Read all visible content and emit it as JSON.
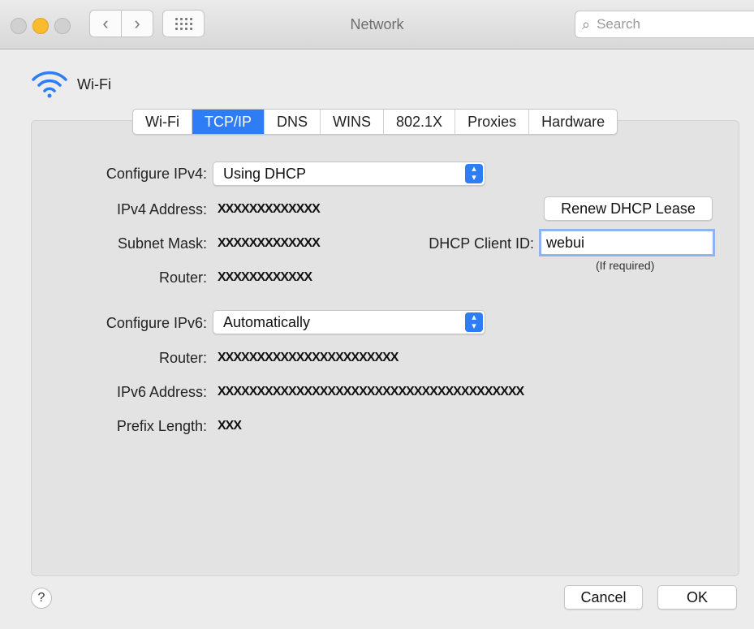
{
  "window": {
    "title": "Network"
  },
  "search": {
    "placeholder": "Search"
  },
  "service": {
    "name": "Wi-Fi"
  },
  "tabs": [
    "Wi-Fi",
    "TCP/IP",
    "DNS",
    "WINS",
    "802.1X",
    "Proxies",
    "Hardware"
  ],
  "active_tab": "TCP/IP",
  "ipv4": {
    "configure_label": "Configure IPv4:",
    "configure_value": "Using DHCP",
    "address_label": "IPv4 Address:",
    "address_value": "XXXXXXXXXXXXX",
    "subnet_label": "Subnet Mask:",
    "subnet_value": "XXXXXXXXXXXXX",
    "router_label": "Router:",
    "router_value": "XXXXXXXXXXXX"
  },
  "dhcp": {
    "renew_label": "Renew DHCP Lease",
    "client_id_label": "DHCP Client ID:",
    "client_id_value": "webui",
    "hint": "(If required)"
  },
  "ipv6": {
    "configure_label": "Configure IPv6:",
    "configure_value": "Automatically",
    "router_label": "Router:",
    "router_value": "XXXXXXXXXXXXXXXXXXXXXXX",
    "address_label": "IPv6 Address:",
    "address_value": "XXXXXXXXXXXXXXXXXXXXXXXXXXXXXXXXXXXXXXX",
    "prefix_label": "Prefix Length:",
    "prefix_value": "XXX"
  },
  "footer": {
    "help_label": "?",
    "cancel_label": "Cancel",
    "ok_label": "OK"
  },
  "colors": {
    "accent": "#2e7cf6",
    "focus_ring": "#8db4ee",
    "minimize": "#fbbb2f"
  }
}
